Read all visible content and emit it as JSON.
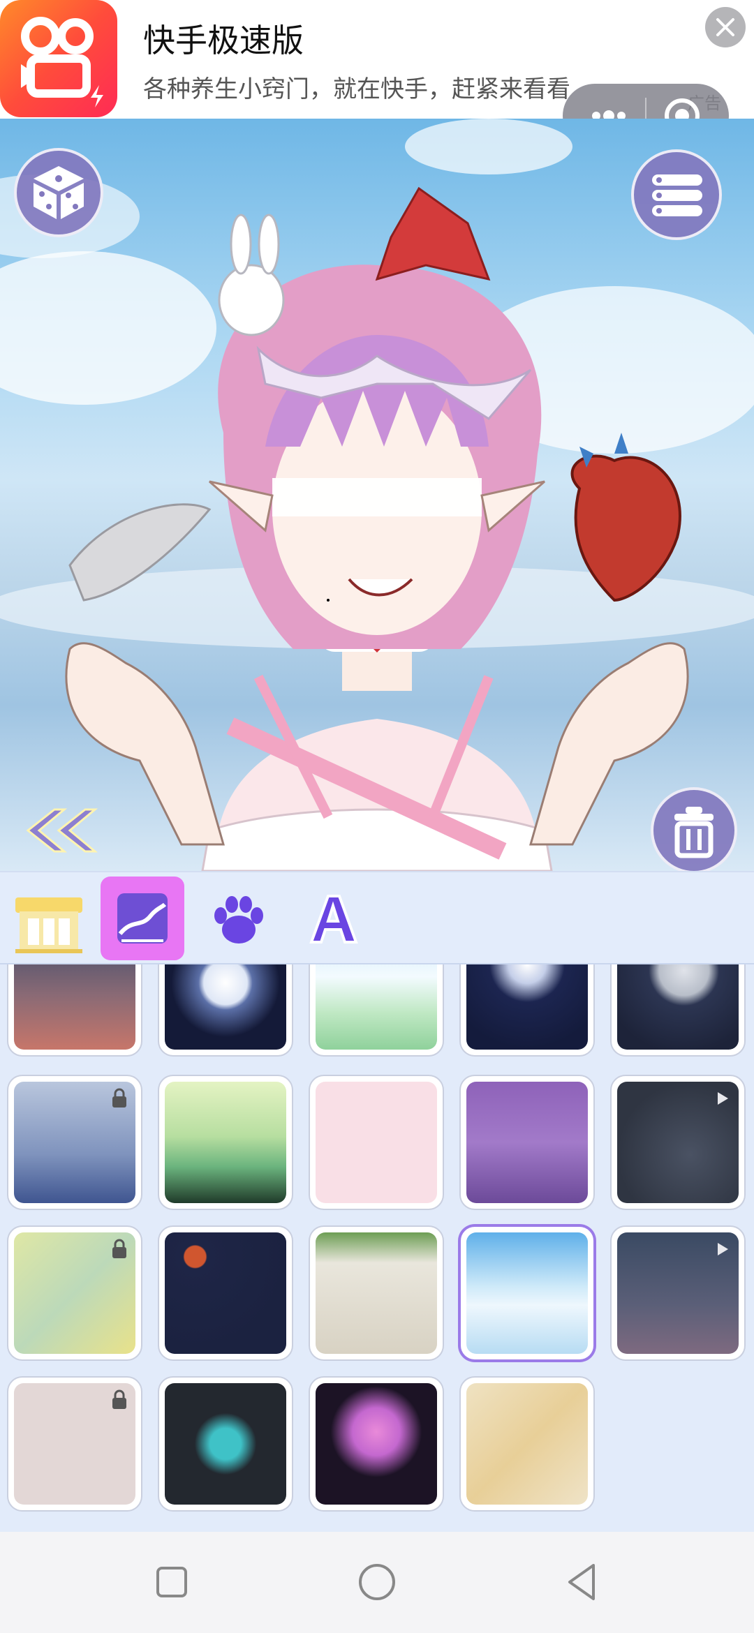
{
  "ad": {
    "title": "快手极速版",
    "subtitle": "各种养生小窍门，就在快手，赶紧来看看",
    "tag": "广告"
  },
  "capsule": {
    "more_icon": "more-dots-icon",
    "exit_icon": "target-exit-icon"
  },
  "stage": {
    "dice_icon": "dice-icon",
    "menu_icon": "list-menu-icon",
    "trash_icon": "trash-icon",
    "back_icon": "double-chevron-left-icon"
  },
  "categories": [
    {
      "id": "shop",
      "icon": "shop-icon",
      "selected": false
    },
    {
      "id": "background",
      "icon": "landscape-icon",
      "selected": true
    },
    {
      "id": "pets",
      "icon": "paw-icon",
      "selected": false
    },
    {
      "id": "text",
      "icon": "letter-a-icon",
      "selected": false
    }
  ],
  "backgrounds": [
    {
      "name": "dusk-clouds",
      "badge": "play"
    },
    {
      "name": "full-moon-night",
      "badge": ""
    },
    {
      "name": "lily-pond",
      "badge": ""
    },
    {
      "name": "moon-over-castle",
      "badge": ""
    },
    {
      "name": "starry-moon",
      "badge": "play"
    },
    {
      "name": "birch-forest",
      "badge": "lock"
    },
    {
      "name": "green-mountain-pines",
      "badge": ""
    },
    {
      "name": "pink-patchwork",
      "badge": ""
    },
    {
      "name": "purple-clouds",
      "badge": ""
    },
    {
      "name": "spider-web",
      "badge": "play"
    },
    {
      "name": "golden-waves",
      "badge": "lock"
    },
    {
      "name": "night-waves-sun",
      "badge": ""
    },
    {
      "name": "stone-wall-ivy",
      "badge": ""
    },
    {
      "name": "sky-clouds",
      "badge": "",
      "selected": true
    },
    {
      "name": "night-sky-pink",
      "badge": "play"
    },
    {
      "name": "pink-pattern",
      "badge": "lock"
    },
    {
      "name": "teal-splash",
      "badge": ""
    },
    {
      "name": "purple-bubbles",
      "badge": ""
    },
    {
      "name": "paper-fans",
      "badge": ""
    }
  ],
  "colors": {
    "accent": "#9b7be8",
    "category_selected": "#e876f4",
    "button": "#8278be"
  }
}
